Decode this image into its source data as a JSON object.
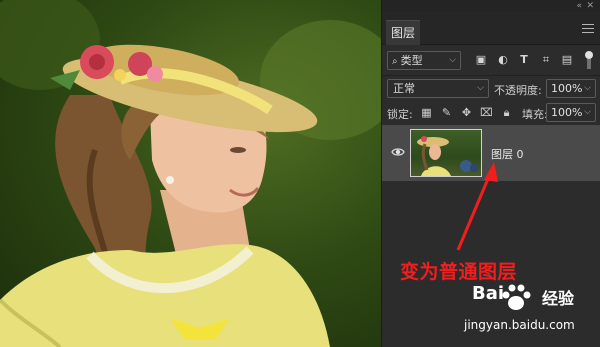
{
  "panel": {
    "collapse_icon": "double-chevron-icon",
    "close_icon": "close-icon",
    "tab_label": "图层",
    "menu_icon": "hamburger-menu-icon"
  },
  "filter": {
    "kind_label": "类型",
    "icons": [
      "image-filter-icon",
      "adjustment-filter-icon",
      "type-filter-icon",
      "shape-filter-icon",
      "smart-object-filter-icon",
      "filter-toggle-icon"
    ]
  },
  "blend": {
    "mode": "正常",
    "opacity_label": "不透明度:",
    "opacity_value": "100%"
  },
  "lock": {
    "label": "锁定:",
    "icons": [
      "lock-transparent-pixels-icon",
      "lock-image-pixels-icon",
      "lock-position-icon",
      "prevent-autonest-icon",
      "lock-all-icon"
    ],
    "fill_label": "填充:",
    "fill_value": "100%"
  },
  "layer": {
    "name": "图层 0",
    "visible": true
  },
  "annotation": {
    "text": "变为普通图层",
    "color": "#f21e1e"
  },
  "watermark": {
    "brand": "Bai",
    "label": "经验",
    "url": "jingyan.baidu.com"
  }
}
